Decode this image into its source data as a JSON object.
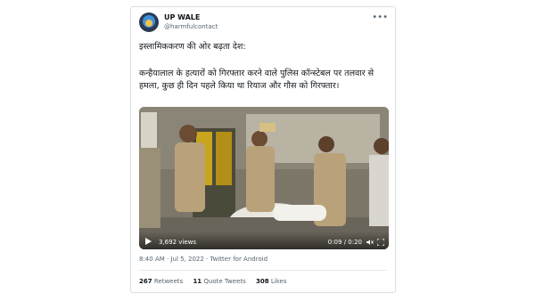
{
  "tweet": {
    "author_name": "UP WALE",
    "author_handle": "@harmfulcontact",
    "more_icon": "more-icon",
    "text_line1": "इस्लामिककरण की ओर बढ़ता देश:",
    "text_body": "कन्हैयालाल के हत्यारों को गिरफ्तार करने वाले पुलिस कॉन्स्टेबल पर तलवार से हमला, कुछ ही दिन पहले किया था रियाज और गौस को गिरफ्तार।",
    "video": {
      "views": "3,692 views",
      "duration": "0:09 / 0:20",
      "play_icon": "play-icon",
      "volume_icon": "volume-icon",
      "fullscreen_icon": "fullscreen-icon"
    },
    "timestamp": "8:40 AM · Jul 5, 2022 · Twitter for Android",
    "stats": {
      "retweets_count": "267",
      "retweets_label": "Retweets",
      "quotes_count": "11",
      "quotes_label": "Quote Tweets",
      "likes_count": "308",
      "likes_label": "Likes"
    }
  },
  "colors": {
    "text_primary": "#0f1419",
    "text_secondary": "#536471",
    "border": "#d9dee2"
  }
}
